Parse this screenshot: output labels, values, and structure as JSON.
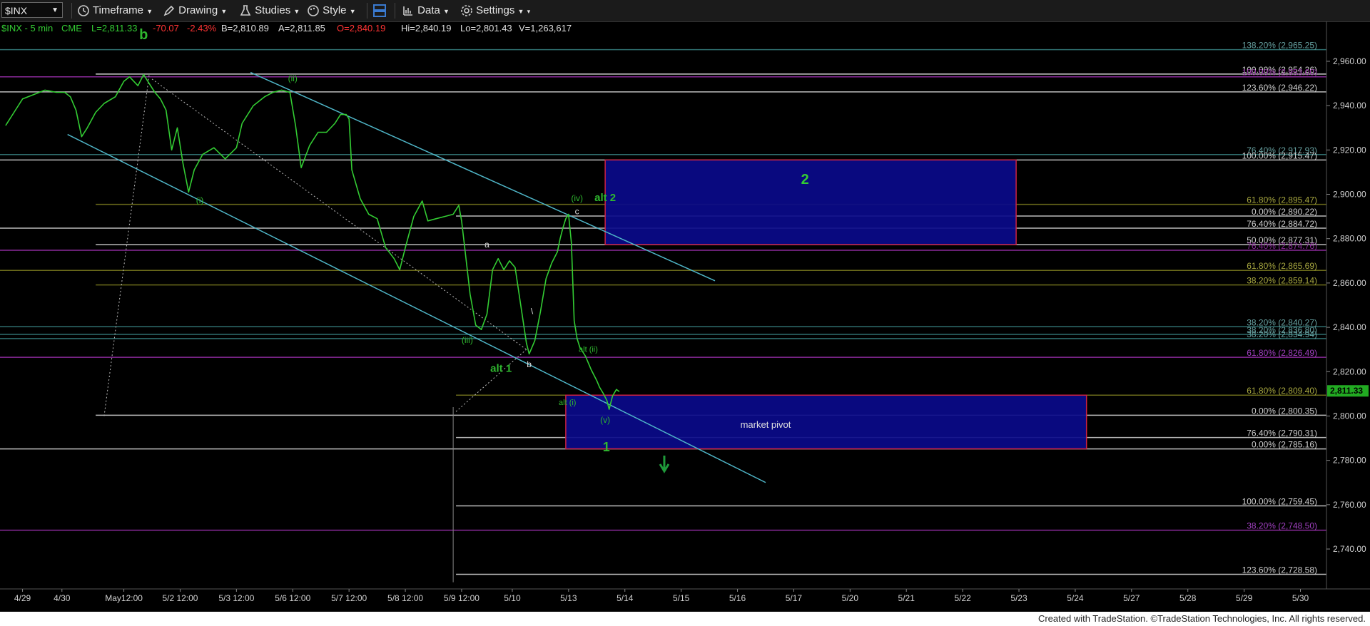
{
  "toolbar": {
    "symbol": "$INX",
    "timeframe": "Timeframe",
    "drawing": "Drawing",
    "studies": "Studies",
    "style": "Style",
    "data": "Data",
    "settings": "Settings"
  },
  "info": {
    "title": "$INX - 5 min",
    "exchange": "CME",
    "last": "L=2,811.33",
    "change": "-70.07",
    "pct": "-2.43%",
    "bid": "B=2,810.89",
    "ask": "A=2,811.85",
    "open": "O=2,840.19",
    "high": "Hi=2,840.19",
    "low": "Lo=2,801.43",
    "volume": "V=1,263,617"
  },
  "footer": "Created with TradeStation. ©TradeStation Technologies, Inc. All rights reserved.",
  "colors": {
    "background": "#000000",
    "price": "#33cc33",
    "wave_label": "#2fb82f",
    "channel": "#4fb6c8",
    "box_fill": "#0a0a8a",
    "box_border": "#cc2244",
    "white_line": "#cfcfcf",
    "purple_line": "#8a2a9a",
    "olive_line": "#6a6a1a",
    "teal_line": "#2f6f6f"
  },
  "chart_data": {
    "type": "line",
    "symbol": "$INX",
    "interval": "5 min",
    "ylim": [
      2722,
      2978
    ],
    "y_ticks": [
      "2,960.00",
      "2,940.00",
      "2,920.00",
      "2,900.00",
      "2,880.00",
      "2,860.00",
      "2,840.00",
      "2,820.00",
      "2,800.00",
      "2,780.00",
      "2,760.00",
      "2,740.00"
    ],
    "last_price": "2,811.33",
    "x_ticks": [
      {
        "label": "4/29",
        "x": 0.3
      },
      {
        "label": "4/30",
        "x": 1.0
      },
      {
        "label": "May12:00",
        "x": 2.1
      },
      {
        "label": "5/2 12:00",
        "x": 3.1
      },
      {
        "label": "5/3 12:00",
        "x": 4.1
      },
      {
        "label": "5/6 12:00",
        "x": 5.1
      },
      {
        "label": "5/7 12:00",
        "x": 6.1
      },
      {
        "label": "5/8 12:00",
        "x": 7.1
      },
      {
        "label": "5/9 12:00",
        "x": 8.1
      },
      {
        "label": "5/10",
        "x": 9.0
      },
      {
        "label": "5/13",
        "x": 10.0
      },
      {
        "label": "5/14",
        "x": 11.0
      },
      {
        "label": "5/15",
        "x": 12.0
      },
      {
        "label": "5/16",
        "x": 13.0
      },
      {
        "label": "5/17",
        "x": 14.0
      },
      {
        "label": "5/20",
        "x": 15.0
      },
      {
        "label": "5/21",
        "x": 16.0
      },
      {
        "label": "5/22",
        "x": 17.0
      },
      {
        "label": "5/23",
        "x": 18.0
      },
      {
        "label": "5/24",
        "x": 19.0
      },
      {
        "label": "5/27",
        "x": 20.0
      },
      {
        "label": "5/28",
        "x": 21.0
      },
      {
        "label": "5/29",
        "x": 22.0
      },
      {
        "label": "5/30",
        "x": 23.0
      }
    ],
    "x_range": [
      -0.1,
      23.45
    ],
    "series": [
      {
        "points": [
          [
            0.0,
            2931
          ],
          [
            0.15,
            2937
          ],
          [
            0.3,
            2943
          ],
          [
            0.5,
            2945
          ],
          [
            0.7,
            2947
          ],
          [
            0.9,
            2946
          ],
          [
            1.05,
            2946
          ],
          [
            1.15,
            2944
          ],
          [
            1.25,
            2938
          ],
          [
            1.35,
            2926
          ],
          [
            1.45,
            2930
          ],
          [
            1.6,
            2937
          ],
          [
            1.75,
            2941
          ],
          [
            1.95,
            2944
          ],
          [
            2.1,
            2951
          ],
          [
            2.2,
            2953
          ],
          [
            2.35,
            2949
          ],
          [
            2.45,
            2954
          ],
          [
            2.55,
            2950
          ],
          [
            2.65,
            2946
          ],
          [
            2.75,
            2943
          ],
          [
            2.85,
            2938
          ],
          [
            2.95,
            2920
          ],
          [
            3.05,
            2930
          ],
          [
            3.15,
            2914
          ],
          [
            3.25,
            2901
          ],
          [
            3.35,
            2911
          ],
          [
            3.5,
            2918
          ],
          [
            3.7,
            2921
          ],
          [
            3.9,
            2916
          ],
          [
            4.1,
            2921
          ],
          [
            4.2,
            2932
          ],
          [
            4.4,
            2940
          ],
          [
            4.6,
            2944
          ],
          [
            4.75,
            2946
          ],
          [
            4.9,
            2947
          ],
          [
            5.05,
            2946
          ],
          [
            5.15,
            2931
          ],
          [
            5.25,
            2912
          ],
          [
            5.4,
            2922
          ],
          [
            5.55,
            2928
          ],
          [
            5.7,
            2928
          ],
          [
            5.85,
            2932
          ],
          [
            5.95,
            2936
          ],
          [
            6.05,
            2936
          ],
          [
            6.1,
            2934
          ],
          [
            6.15,
            2911
          ],
          [
            6.3,
            2898
          ],
          [
            6.45,
            2891
          ],
          [
            6.6,
            2889
          ],
          [
            6.75,
            2876
          ],
          [
            6.9,
            2871
          ],
          [
            7.0,
            2866
          ],
          [
            7.1,
            2876
          ],
          [
            7.25,
            2890
          ],
          [
            7.4,
            2897
          ],
          [
            7.5,
            2888
          ],
          [
            7.65,
            2889
          ],
          [
            7.8,
            2890
          ],
          [
            7.95,
            2891
          ],
          [
            8.05,
            2895
          ],
          [
            8.1,
            2888
          ],
          [
            8.15,
            2877
          ],
          [
            8.25,
            2855
          ],
          [
            8.35,
            2841
          ],
          [
            8.45,
            2839
          ],
          [
            8.55,
            2846
          ],
          [
            8.65,
            2866
          ],
          [
            8.75,
            2871
          ],
          [
            8.85,
            2866
          ],
          [
            8.95,
            2870
          ],
          [
            9.05,
            2867
          ],
          [
            9.15,
            2850
          ],
          [
            9.25,
            2833
          ],
          [
            9.3,
            2828
          ],
          [
            9.4,
            2834
          ],
          [
            9.5,
            2847
          ],
          [
            9.6,
            2862
          ],
          [
            9.7,
            2869
          ],
          [
            9.8,
            2874
          ],
          [
            9.85,
            2880
          ],
          [
            9.9,
            2885
          ],
          [
            9.95,
            2889
          ],
          [
            10.0,
            2891
          ],
          [
            10.05,
            2878
          ],
          [
            10.1,
            2843
          ],
          [
            10.15,
            2835
          ],
          [
            10.2,
            2831
          ],
          [
            10.3,
            2827
          ],
          [
            10.4,
            2821
          ],
          [
            10.5,
            2816
          ],
          [
            10.55,
            2813
          ],
          [
            10.62,
            2810
          ],
          [
            10.68,
            2807
          ],
          [
            10.72,
            2803
          ],
          [
            10.78,
            2809
          ],
          [
            10.85,
            2812
          ],
          [
            10.9,
            2811
          ]
        ]
      }
    ],
    "levels": [
      {
        "label": "138.20% (2,965.25)",
        "y": 2965.25,
        "color": "#2f6f6f",
        "text_color": "#66a0a0",
        "x_start": -0.1
      },
      {
        "label": "100.00% (2,954.26)",
        "y": 2954.26,
        "color": "#cfcfcf",
        "text_color": "#cfcfcf",
        "x_start": 1.6
      },
      {
        "label": "100.00% (2,953.00)",
        "y": 2953.0,
        "color": "#8a2a9a",
        "text_color": "#8a2a9a",
        "x_start": -0.1
      },
      {
        "label": "123.60% (2,946.22)",
        "y": 2946.22,
        "color": "#bbbbbb",
        "text_color": "#cfcfcf",
        "x_start": -0.1
      },
      {
        "label": "76.40% (2,917.93)",
        "y": 2917.93,
        "color": "#2f6f6f",
        "text_color": "#66a0a0",
        "x_start": -0.1
      },
      {
        "label": "100.00% (2,915.47)",
        "y": 2915.47,
        "color": "#bbbbbb",
        "text_color": "#cfcfcf",
        "x_start": -0.1
      },
      {
        "label": "61.80% (2,895.47)",
        "y": 2895.47,
        "color": "#6a6a1a",
        "text_color": "#a8a840",
        "x_start": 1.6
      },
      {
        "label": "0.00% (2,890.22)",
        "y": 2890.22,
        "color": "#bbbbbb",
        "text_color": "#cfcfcf",
        "x_start": 8.0
      },
      {
        "label": "76.40% (2,884.72)",
        "y": 2884.72,
        "color": "#bbbbbb",
        "text_color": "#cfcfcf",
        "x_start": -0.1
      },
      {
        "label": "50.00% (2,877.31)",
        "y": 2877.31,
        "color": "#bbbbbb",
        "text_color": "#cfcfcf",
        "x_start": 1.6
      },
      {
        "label": "76.40% (2,874.76)",
        "y": 2874.76,
        "color": "#8a2a9a",
        "text_color": "#8a2a9a",
        "x_start": -0.1
      },
      {
        "label": "61.80% (2,865.69)",
        "y": 2865.69,
        "color": "#6a6a1a",
        "text_color": "#a8a840",
        "x_start": -0.1
      },
      {
        "label": "38.20% (2,859.14)",
        "y": 2859.14,
        "color": "#6a6a1a",
        "text_color": "#a8a840",
        "x_start": 1.6
      },
      {
        "label": "38.20% (2,840.27)",
        "y": 2840.27,
        "color": "#2f6f6f",
        "text_color": "#66a0a0",
        "x_start": -0.1
      },
      {
        "label": "38.20% (2,836.80)",
        "y": 2836.8,
        "color": "#2f6f6f",
        "text_color": "#66a0a0",
        "x_start": -0.1
      },
      {
        "label": "38.20% (2,834.94)",
        "y": 2834.94,
        "color": "#2f6f6f",
        "text_color": "#66a0a0",
        "x_start": -0.1
      },
      {
        "label": "61.80% (2,826.49)",
        "y": 2826.49,
        "color": "#8a2a9a",
        "text_color": "#a040c0",
        "x_start": -0.1
      },
      {
        "label": "61.80% (2,809.40)",
        "y": 2809.4,
        "color": "#6a6a1a",
        "text_color": "#a8a840",
        "x_start": 8.0
      },
      {
        "label": "0.00% (2,800.35)",
        "y": 2800.35,
        "color": "#bbbbbb",
        "text_color": "#cfcfcf",
        "x_start": 1.6
      },
      {
        "label": "76.40% (2,790.31)",
        "y": 2790.31,
        "color": "#bbbbbb",
        "text_color": "#cfcfcf",
        "x_start": 8.0
      },
      {
        "label": "0.00% (2,785.16)",
        "y": 2785.16,
        "color": "#bbbbbb",
        "text_color": "#cfcfcf",
        "x_start": -0.1
      },
      {
        "label": "100.00% (2,759.45)",
        "y": 2759.45,
        "color": "#bbbbbb",
        "text_color": "#cfcfcf",
        "x_start": 8.0
      },
      {
        "label": "38.20% (2,748.50)",
        "y": 2748.5,
        "color": "#8a2a9a",
        "text_color": "#a040c0",
        "x_start": -0.1
      },
      {
        "label": "123.60% (2,728.58)",
        "y": 2728.58,
        "color": "#bbbbbb",
        "text_color": "#cfcfcf",
        "x_start": 8.0
      }
    ],
    "boxes": [
      {
        "x1": 10.65,
        "x2": 17.95,
        "y1": 2877.3,
        "y2": 2915.5,
        "label": "2"
      },
      {
        "x1": 9.95,
        "x2": 19.2,
        "y1": 2785.2,
        "y2": 2809.4,
        "label": "market pivot"
      }
    ],
    "trendlines": [
      {
        "points": [
          [
            1.1,
            2927
          ],
          [
            13.5,
            2770
          ]
        ],
        "kind": "channel"
      },
      {
        "points": [
          [
            4.35,
            2955
          ],
          [
            12.6,
            2861
          ]
        ],
        "kind": "channel"
      },
      {
        "points": [
          [
            1.75,
            2800
          ],
          [
            2.55,
            2954
          ]
        ],
        "kind": "dotted"
      },
      {
        "points": [
          [
            2.6,
            2952
          ],
          [
            9.25,
            2830
          ]
        ],
        "kind": "dotted"
      },
      {
        "points": [
          [
            8.0,
            2802
          ],
          [
            9.25,
            2830
          ]
        ],
        "kind": "dotted"
      },
      {
        "points": [
          [
            7.95,
            2725
          ],
          [
            7.95,
            2804
          ]
        ],
        "kind": "vertical"
      }
    ],
    "wave_labels": [
      {
        "text": "b",
        "x": 2.45,
        "y": 2970,
        "size": 20
      },
      {
        "text": "(i)",
        "x": 3.45,
        "y": 2896,
        "size": 12
      },
      {
        "text": "(ii)",
        "x": 5.1,
        "y": 2951,
        "size": 12
      },
      {
        "text": "(iii)",
        "x": 8.2,
        "y": 2833,
        "size": 12
      },
      {
        "text": "alt 1",
        "x": 8.8,
        "y": 2820,
        "size": 15
      },
      {
        "text": "(iv)",
        "x": 10.15,
        "y": 2897,
        "size": 12
      },
      {
        "text": "alt 2",
        "x": 10.65,
        "y": 2897,
        "size": 15
      },
      {
        "text": "alt (ii)",
        "x": 10.35,
        "y": 2829,
        "size": 11
      },
      {
        "text": "alt (i)",
        "x": 9.98,
        "y": 2805,
        "size": 11
      },
      {
        "text": "(v)",
        "x": 10.65,
        "y": 2797,
        "size": 12
      },
      {
        "text": "1",
        "x": 10.67,
        "y": 2784,
        "size": 18
      },
      {
        "text": "2",
        "x": 14.2,
        "y": 2906,
        "size": 18
      }
    ],
    "point_labels": [
      {
        "text": "a",
        "x": 8.55,
        "y": 2876
      },
      {
        "text": "b",
        "x": 9.3,
        "y": 2822
      },
      {
        "text": "c",
        "x": 10.15,
        "y": 2891
      },
      {
        "text": "\\",
        "x": 9.35,
        "y": 2846
      }
    ]
  }
}
